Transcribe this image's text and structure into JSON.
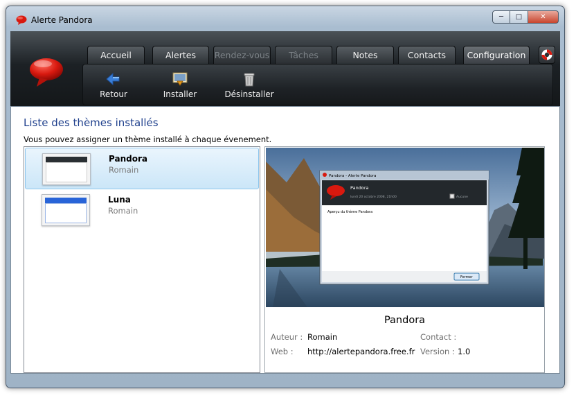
{
  "window": {
    "title": "Alerte Pandora",
    "buttons": {
      "minimize": "─",
      "maximize": "□",
      "close": "✕"
    }
  },
  "tabs": [
    {
      "label": "Accueil",
      "state": "normal"
    },
    {
      "label": "Alertes",
      "state": "normal"
    },
    {
      "label": "Rendez-vous",
      "state": "disabled"
    },
    {
      "label": "Tâches",
      "state": "disabled"
    },
    {
      "label": "Notes",
      "state": "normal"
    },
    {
      "label": "Contacts",
      "state": "normal"
    },
    {
      "label": "Configuration",
      "state": "active"
    }
  ],
  "toolbar": {
    "back_label": "Retour",
    "install_label": "Installer",
    "uninstall_label": "Désinstaller"
  },
  "content": {
    "title": "Liste des thèmes installés",
    "description": "Vous pouvez assigner un thème installé à chaque évenement."
  },
  "themes": [
    {
      "name": "Pandora",
      "author": "Romain",
      "selected": true
    },
    {
      "name": "Luna",
      "author": "Romain",
      "selected": false
    }
  ],
  "preview": {
    "dialog_title": "Pandora - Alerte Pandora",
    "dialog_heading": "Pandora",
    "dialog_date": "lundi 20 octobre 2008, 21h00",
    "dialog_checkbox": "Aucune",
    "dialog_body": "Aperçu du thème Pandora",
    "dialog_button": "Fermer",
    "name": "Pandora",
    "author_label": "Auteur :",
    "author": "Romain",
    "contact_label": "Contact :",
    "contact": "",
    "web_label": "Web :",
    "web": "http://alertepandora.free.fr",
    "version_label": "Version :",
    "version": "1.0"
  },
  "colors": {
    "accent_title": "#1e3f8c",
    "selection_border": "#8ec6ed",
    "header_dark": "#1c2125",
    "logo_red": "#d8190f"
  },
  "icons": {
    "app": "speech-bubble-icon",
    "help": "lifebuoy-icon",
    "back": "arrow-left-icon",
    "install": "install-icon",
    "uninstall": "trash-icon"
  }
}
